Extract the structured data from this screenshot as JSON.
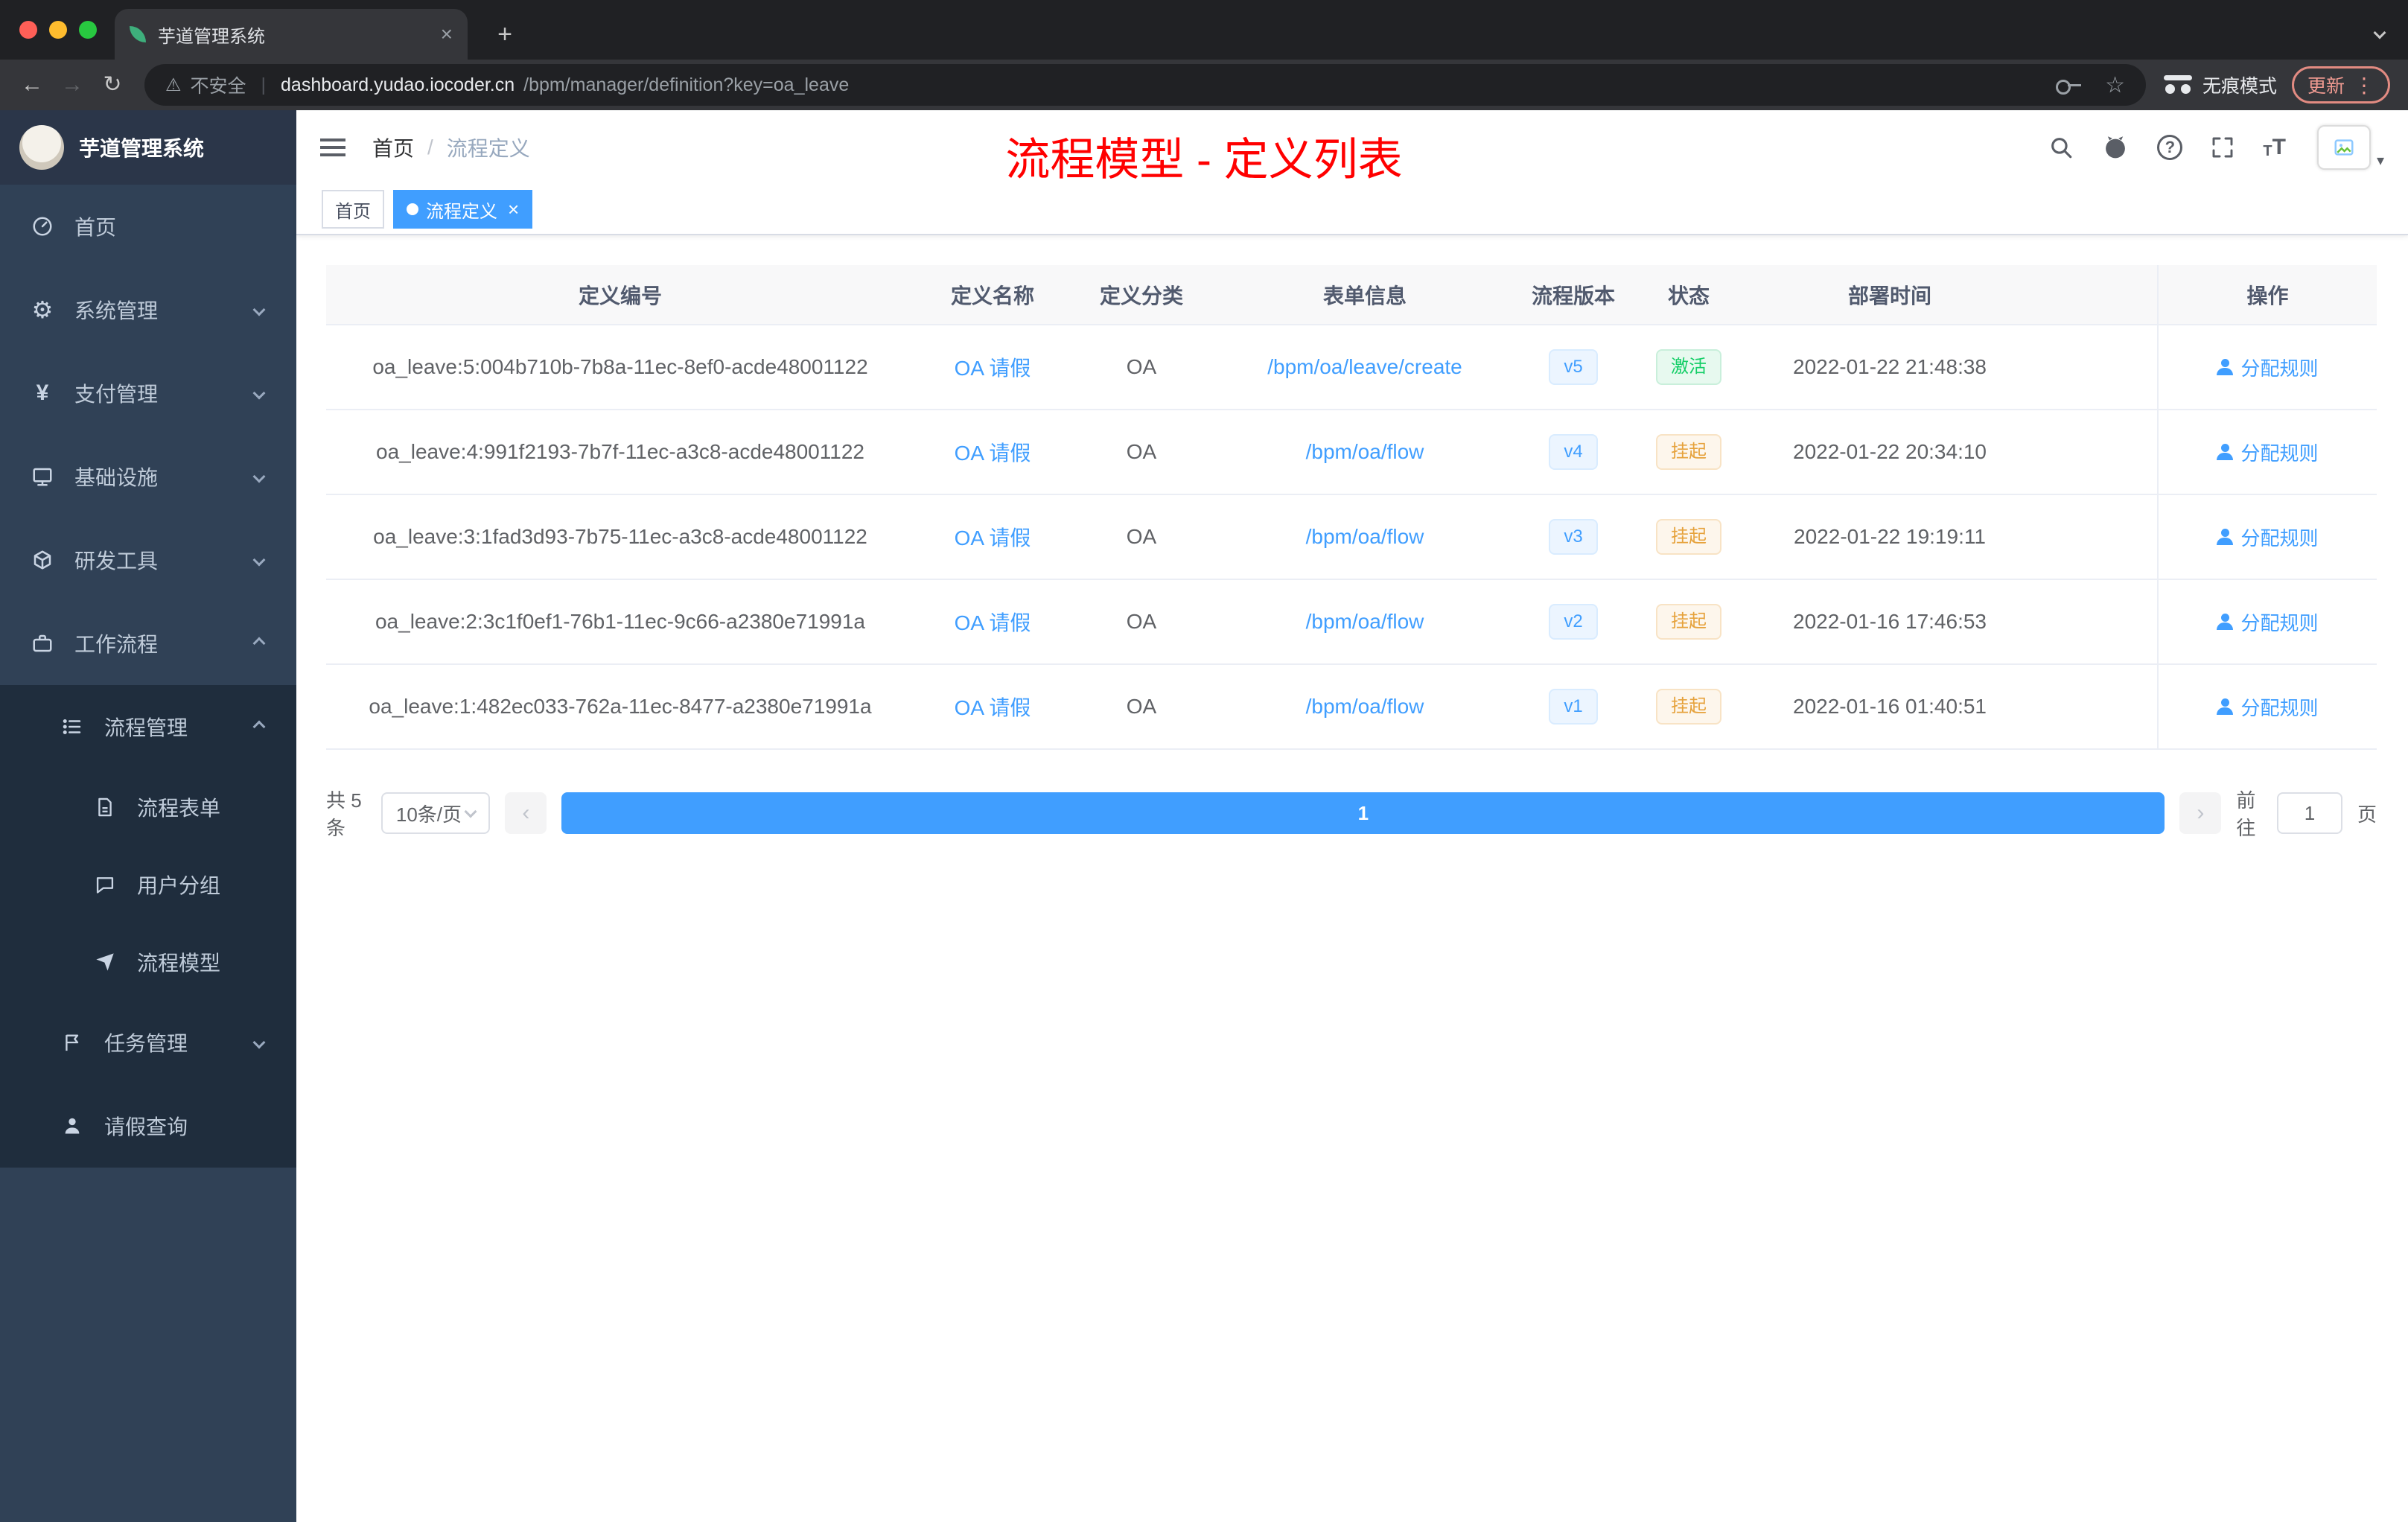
{
  "colors": {
    "primary": "#409eff",
    "success": "#13ce66",
    "warning": "#e6a23c",
    "sidebar_bg": "#304156",
    "submenu_bg": "#1f2d3d",
    "annotation": "#ff0000"
  },
  "icons": {
    "back": "←",
    "forward": "→",
    "reload": "↻",
    "warning": "⚠",
    "star": "☆",
    "dots": "⋮",
    "new_tab": "+",
    "close": "×",
    "gear": "⚙",
    "yen": "¥",
    "question": "?",
    "prev": "‹",
    "next": "›",
    "caret_down": "▾",
    "font_large": "T",
    "font_small": "T"
  },
  "browser": {
    "tab_title": "芋道管理系统",
    "security_label": "不安全",
    "url_host": "dashboard.yudao.iocoder.cn",
    "url_path": "/bpm/manager/definition?key=oa_leave",
    "incognito_label": "无痕模式",
    "update_label": "更新"
  },
  "sidebar": {
    "logo_title": "芋道管理系统",
    "home": "首页",
    "system": "系统管理",
    "payment": "支付管理",
    "infra": "基础设施",
    "devtools": "研发工具",
    "workflow": "工作流程",
    "process_manage": "流程管理",
    "process_form": "流程表单",
    "user_group": "用户分组",
    "process_model": "流程模型",
    "task_manage": "任务管理",
    "leave_query": "请假查询"
  },
  "header": {
    "breadcrumb_home": "首页",
    "breadcrumb_separator": "/",
    "breadcrumb_current": "流程定义",
    "annotation": "流程模型 - 定义列表"
  },
  "tags": {
    "home": "首页",
    "current": "流程定义"
  },
  "table": {
    "columns": [
      "定义编号",
      "定义名称",
      "定义分类",
      "表单信息",
      "流程版本",
      "状态",
      "部署时间",
      "操作"
    ],
    "rows": [
      {
        "id": "oa_leave:5:004b710b-7b8a-11ec-8ef0-acde48001122",
        "name": "OA 请假",
        "category": "OA",
        "form": "/bpm/oa/leave/create",
        "version": "v5",
        "status": "激活",
        "status_type": "success",
        "deploy_time": "2022-01-22 21:48:38",
        "action": "分配规则"
      },
      {
        "id": "oa_leave:4:991f2193-7b7f-11ec-a3c8-acde48001122",
        "name": "OA 请假",
        "category": "OA",
        "form": "/bpm/oa/flow",
        "version": "v4",
        "status": "挂起",
        "status_type": "warning",
        "deploy_time": "2022-01-22 20:34:10",
        "action": "分配规则"
      },
      {
        "id": "oa_leave:3:1fad3d93-7b75-11ec-a3c8-acde48001122",
        "name": "OA 请假",
        "category": "OA",
        "form": "/bpm/oa/flow",
        "version": "v3",
        "status": "挂起",
        "status_type": "warning",
        "deploy_time": "2022-01-22 19:19:11",
        "action": "分配规则"
      },
      {
        "id": "oa_leave:2:3c1f0ef1-76b1-11ec-9c66-a2380e71991a",
        "name": "OA 请假",
        "category": "OA",
        "form": "/bpm/oa/flow",
        "version": "v2",
        "status": "挂起",
        "status_type": "warning",
        "deploy_time": "2022-01-16 17:46:53",
        "action": "分配规则"
      },
      {
        "id": "oa_leave:1:482ec033-762a-11ec-8477-a2380e71991a",
        "name": "OA 请假",
        "category": "OA",
        "form": "/bpm/oa/flow",
        "version": "v1",
        "status": "挂起",
        "status_type": "warning",
        "deploy_time": "2022-01-16 01:40:51",
        "action": "分配规则"
      }
    ]
  },
  "pagination": {
    "total": "共 5 条",
    "page_size": "10条/页",
    "current_page": "1",
    "goto_label": "前往",
    "goto_value": "1",
    "unit_label": "页"
  }
}
